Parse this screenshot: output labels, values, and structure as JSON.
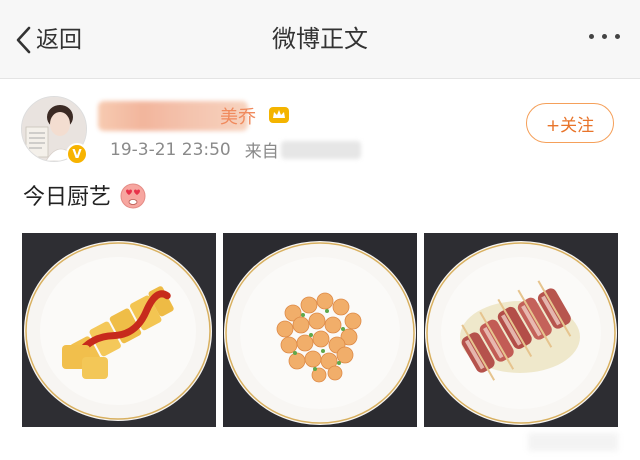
{
  "nav": {
    "back_label": "返回",
    "title": "微博正文"
  },
  "post": {
    "username": "美乔",
    "timestamp": "19-3-21 23:50",
    "source_prefix": "来自",
    "follow_label": "+关注",
    "text": "今日厨艺",
    "photos": [
      {
        "name": "photo-rolled-omelette",
        "dish": "omelette rolls with ketchup"
      },
      {
        "name": "photo-shrimp",
        "dish": "stir-fried shrimp with scallion"
      },
      {
        "name": "photo-bacon-rolls",
        "dish": "bacon rolls on skewers"
      }
    ]
  },
  "colors": {
    "accent": "#f08a5d",
    "follow_border": "#f5a05a",
    "meta_text": "#8a8a8a",
    "verify_badge": "#f7b300",
    "plate_rim": "#d8b060"
  },
  "icons": [
    "back-chevron-icon",
    "more-icon",
    "verified-badge-icon",
    "crown-icon",
    "heart-eyes-emoji-icon"
  ]
}
